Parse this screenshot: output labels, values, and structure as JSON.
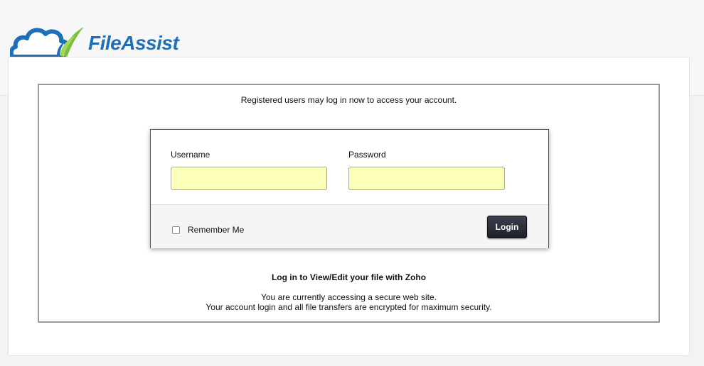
{
  "brand": {
    "name": "FileAssist",
    "logo_icon": "cloud-leaf-logo-icon",
    "colors": {
      "blue": "#1f6fb8",
      "green": "#79bf3f"
    }
  },
  "intro_text": "Registered users may log in now to access your account.",
  "login": {
    "username_label": "Username",
    "username_value": "",
    "password_label": "Password",
    "password_value": "",
    "remember_label": "Remember Me",
    "remember_checked": false,
    "submit_label": "Login",
    "input_color": "#fbffb8"
  },
  "zoho_text": "Log in to View/Edit your file with Zoho",
  "secure_line1": "You are currently accessing a secure web site.",
  "secure_line2": "Your account login and all file transfers are encrypted for maximum security."
}
